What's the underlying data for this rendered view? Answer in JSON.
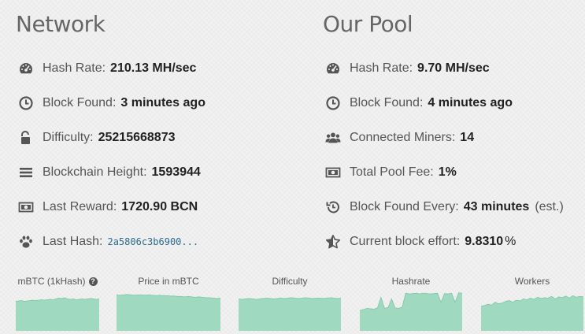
{
  "network": {
    "title": "Network",
    "stats": [
      {
        "icon": "dashboard-icon",
        "label": "Hash Rate:",
        "value": "210.13 MH/sec"
      },
      {
        "icon": "clock-icon",
        "label": "Block Found:",
        "value": "3 minutes ago"
      },
      {
        "icon": "unlock-icon",
        "label": "Difficulty:",
        "value": "25215668873"
      },
      {
        "icon": "bars-icon",
        "label": "Blockchain Height:",
        "value": "1593944"
      },
      {
        "icon": "money-icon",
        "label": "Last Reward:",
        "value": "1720.90 BCN"
      },
      {
        "icon": "paw-icon",
        "label": "Last Hash:",
        "value": "2a5806c3b6900..."
      }
    ]
  },
  "pool": {
    "title": "Our Pool",
    "stats": [
      {
        "icon": "dashboard-icon",
        "label": "Hash Rate:",
        "value": "9.70 MH/sec"
      },
      {
        "icon": "clock-icon",
        "label": "Block Found:",
        "value": "4 minutes ago"
      },
      {
        "icon": "users-icon",
        "label": "Connected Miners:",
        "value": "14"
      },
      {
        "icon": "money-icon",
        "label": "Total Pool Fee:",
        "value": "1%"
      },
      {
        "icon": "history-icon",
        "label": "Block Found Every:",
        "value": "43 minutes",
        "suffix": "(est.)"
      },
      {
        "icon": "star-half-icon",
        "label": "Current block effort:",
        "value": "9.8310",
        "suffix": "%"
      }
    ]
  },
  "charts": {
    "labels": [
      "mBTC (1kHash)",
      "Price in mBTC",
      "Difficulty",
      "Hashrate",
      "Workers"
    ],
    "fill_color": "#9fd9c0",
    "stroke_color": "#7cc7a6",
    "series": [
      [
        0.72,
        0.73,
        0.74,
        0.72,
        0.73,
        0.74,
        0.75,
        0.74,
        0.75,
        0.76,
        0.75,
        0.76,
        0.77,
        0.76,
        0.78,
        0.8,
        0.79,
        0.81,
        0.78,
        0.77,
        0.78,
        0.76,
        0.77,
        0.78,
        0.77,
        0.78,
        0.79,
        0.78,
        0.77,
        0.78
      ],
      [
        0.88,
        0.87,
        0.88,
        0.89,
        0.88,
        0.87,
        0.88,
        0.88,
        0.87,
        0.88,
        0.87,
        0.86,
        0.87,
        0.86,
        0.86,
        0.85,
        0.85,
        0.84,
        0.84,
        0.83,
        0.84,
        0.83,
        0.82,
        0.83,
        0.82,
        0.81,
        0.81,
        0.8,
        0.79,
        0.8
      ],
      [
        0.78,
        0.77,
        0.78,
        0.79,
        0.78,
        0.77,
        0.78,
        0.79,
        0.8,
        0.79,
        0.78,
        0.79,
        0.8,
        0.79,
        0.8,
        0.81,
        0.8,
        0.79,
        0.8,
        0.81,
        0.8,
        0.79,
        0.8,
        0.8,
        0.79,
        0.8,
        0.81,
        0.8,
        0.79,
        0.8
      ],
      [
        0.5,
        0.52,
        0.55,
        0.54,
        0.53,
        0.56,
        0.82,
        0.55,
        0.57,
        0.78,
        0.56,
        0.55,
        0.58,
        0.92,
        0.9,
        0.91,
        0.92,
        0.9,
        0.92,
        0.91,
        0.9,
        0.91,
        0.92,
        0.7,
        0.91,
        0.9,
        0.92,
        0.7,
        0.93,
        0.92
      ],
      [
        0.6,
        0.62,
        0.65,
        0.63,
        0.7,
        0.66,
        0.68,
        0.72,
        0.74,
        0.7,
        0.75,
        0.73,
        0.78,
        0.76,
        0.8,
        0.77,
        0.82,
        0.79,
        0.81,
        0.8,
        0.84,
        0.78,
        0.83,
        0.81,
        0.85,
        0.8,
        0.86,
        0.82,
        0.84,
        0.83
      ]
    ]
  }
}
